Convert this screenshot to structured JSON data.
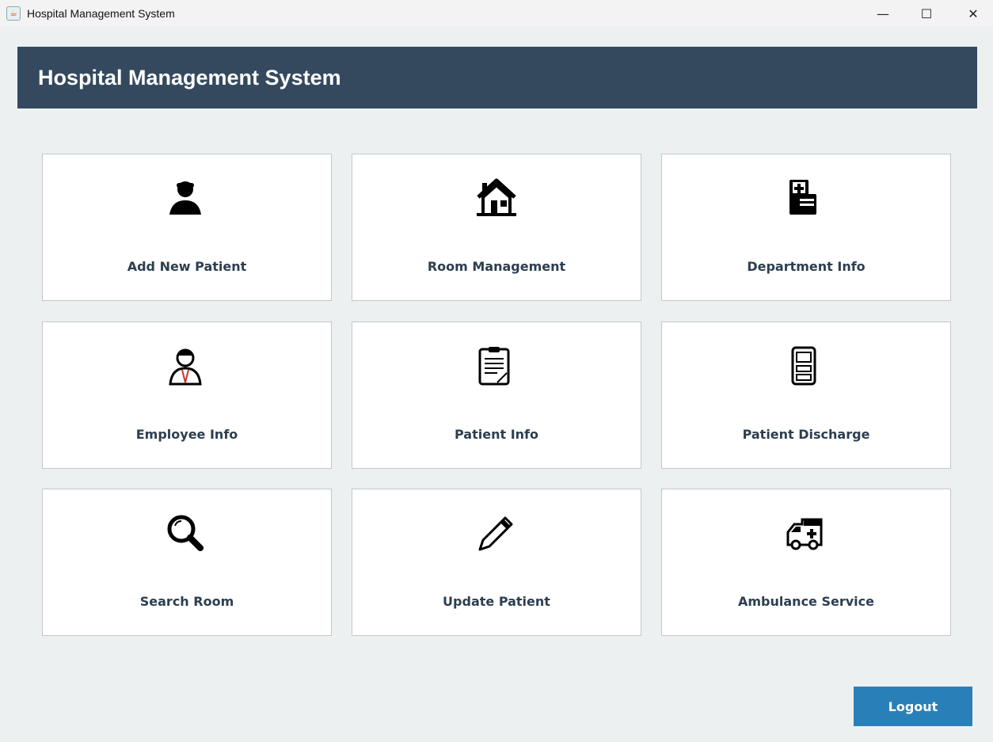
{
  "window": {
    "title": "Hospital Management System",
    "controls": [
      "minimize",
      "maximize",
      "close"
    ]
  },
  "header": {
    "title": "Hospital Management System",
    "bg": "#34495e"
  },
  "cards": [
    {
      "label": "Add New Patient",
      "icon": "person-icon"
    },
    {
      "label": "Room Management",
      "icon": "house-icon"
    },
    {
      "label": "Department Info",
      "icon": "hospital-building-icon"
    },
    {
      "label": "Employee Info",
      "icon": "doctor-icon"
    },
    {
      "label": "Patient Info",
      "icon": "clipboard-icon"
    },
    {
      "label": "Patient Discharge",
      "icon": "door-icon"
    },
    {
      "label": "Search Room",
      "icon": "magnifier-icon"
    },
    {
      "label": "Update Patient",
      "icon": "pencil-icon"
    },
    {
      "label": "Ambulance Service",
      "icon": "ambulance-icon"
    }
  ],
  "logout": {
    "label": "Logout",
    "bg": "#2980b9"
  }
}
